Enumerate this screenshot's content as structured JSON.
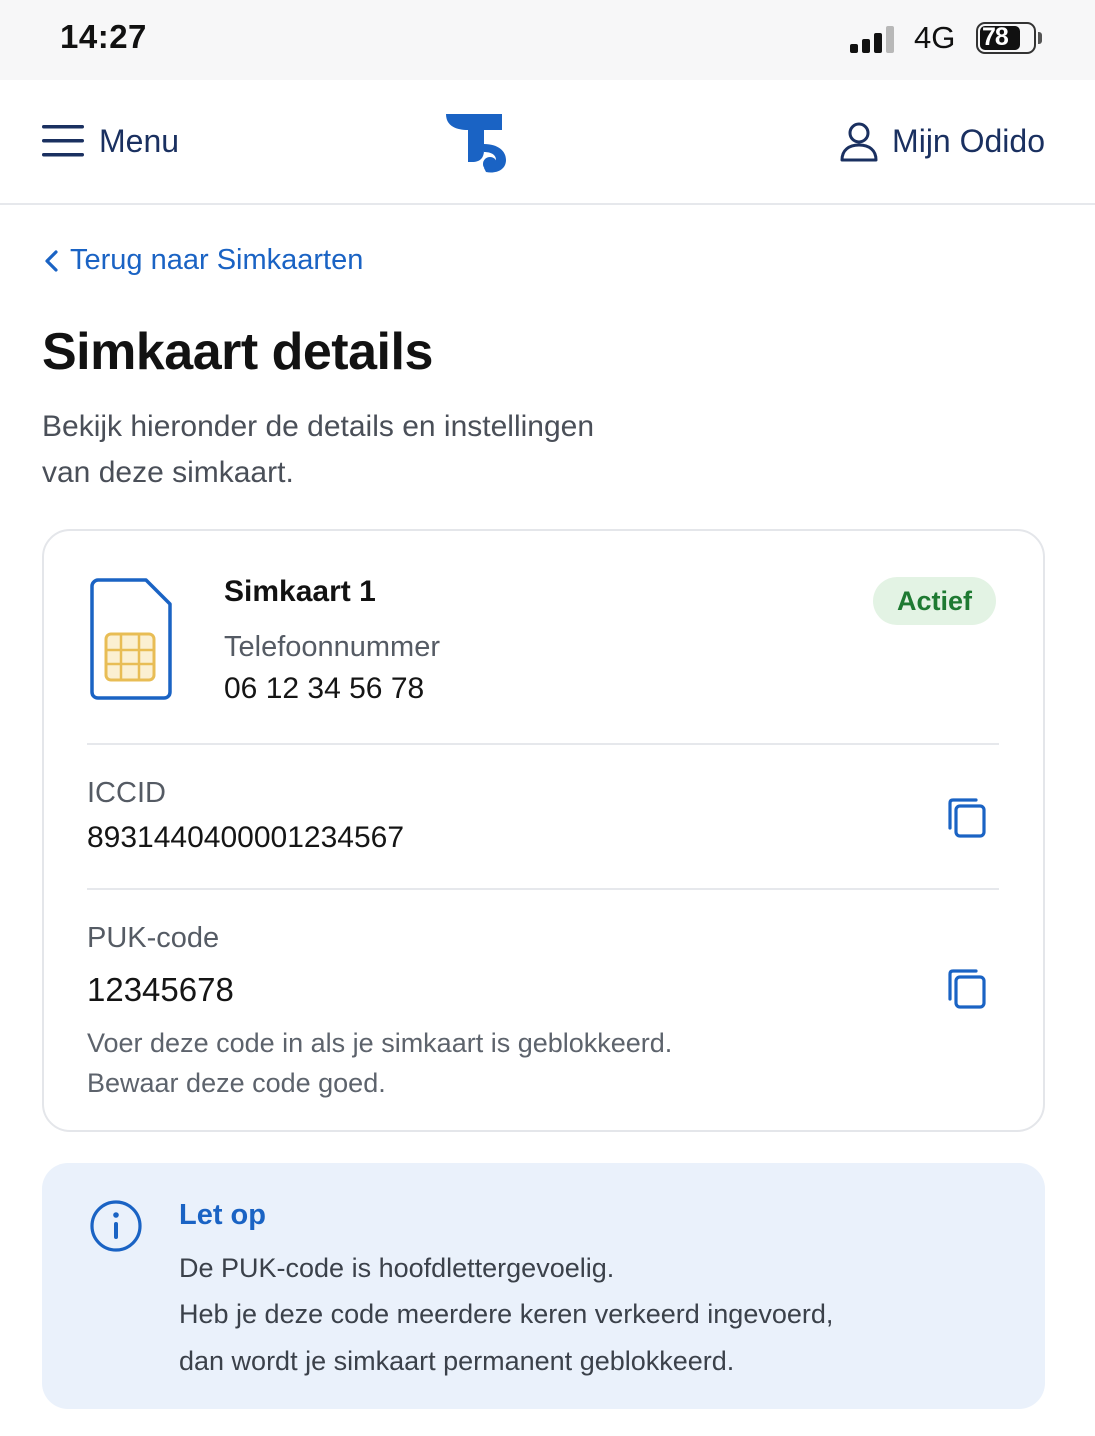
{
  "status_bar": {
    "time": "14:27",
    "network": "4G",
    "battery": "78",
    "icons": [
      "signal-bars-icon",
      "battery-icon"
    ]
  },
  "header": {
    "menu_label": "Menu",
    "account_label": "Mijn Odido",
    "icons": [
      "hamburger-icon",
      "odido-logo",
      "user-icon"
    ],
    "brand_color": "#1a63c4"
  },
  "back_link": {
    "label": "Terug naar Simkaarten",
    "icon": "chevron-left-icon"
  },
  "page": {
    "title": "Simkaart details",
    "subtitle_line1": "Bekijk hieronder de details en instellingen",
    "subtitle_line2": "van deze simkaart."
  },
  "sim_card": {
    "name": "Simkaart 1",
    "status": "Actief",
    "status_color": "#1e7a32",
    "phone_label": "Telefoonnummer",
    "phone_value": "06 12 34 56 78",
    "icon": "sim-card-icon",
    "fields": [
      {
        "label": "ICCID",
        "value": "8931440400001234567",
        "action_icon": "copy-icon"
      },
      {
        "label": "PUK-code",
        "value": "12345678",
        "action_icon": "copy-icon"
      }
    ],
    "puk_note_line1": "Voer deze code in als je simkaart is geblokkeerd.",
    "puk_note_line2": "Bewaar deze code goed."
  },
  "notice": {
    "title": "Let op",
    "icon": "info-icon",
    "line1": "De PUK-code is hoofdlettergevoelig.",
    "line2": "Heb je deze code meerdere keren verkeerd ingevoerd,",
    "line3": "dan wordt je simkaart permanent geblokkeerd.",
    "background": "#eaf1fb"
  }
}
